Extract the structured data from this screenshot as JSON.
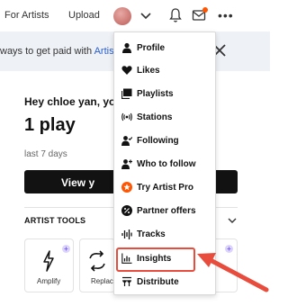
{
  "topbar": {
    "for_artists": "For Artists",
    "upload": "Upload"
  },
  "banner": {
    "text": "ways to get paid with ",
    "link": "Artist Pr"
  },
  "main": {
    "greeting": "Hey chloe yan, you",
    "plays": "1 play",
    "period": "last 7 days",
    "view_button": "View y"
  },
  "artist_tools": {
    "title": "ARTIST TOOLS",
    "cards": [
      {
        "label": "Amplify",
        "icon": "amplify-icon"
      },
      {
        "label": "Replac",
        "icon": "replace-icon"
      }
    ]
  },
  "menu": {
    "items": [
      {
        "label": "Profile",
        "icon": "person-icon"
      },
      {
        "label": "Likes",
        "icon": "heart-icon"
      },
      {
        "label": "Playlists",
        "icon": "playlist-icon"
      },
      {
        "label": "Stations",
        "icon": "stations-icon"
      },
      {
        "label": "Following",
        "icon": "following-icon"
      },
      {
        "label": "Who to follow",
        "icon": "add-person-icon"
      },
      {
        "label": "Try Artist Pro",
        "icon": "star-icon"
      },
      {
        "label": "Partner offers",
        "icon": "percent-icon"
      },
      {
        "label": "Tracks",
        "icon": "tracks-icon"
      },
      {
        "label": "Insights",
        "icon": "insights-icon"
      },
      {
        "label": "Distribute",
        "icon": "distribute-icon"
      }
    ]
  },
  "colors": {
    "accent": "#ff5500",
    "highlight": "#e74c3c",
    "link": "#2a5ec9",
    "banner_bg": "#eef1f6"
  }
}
